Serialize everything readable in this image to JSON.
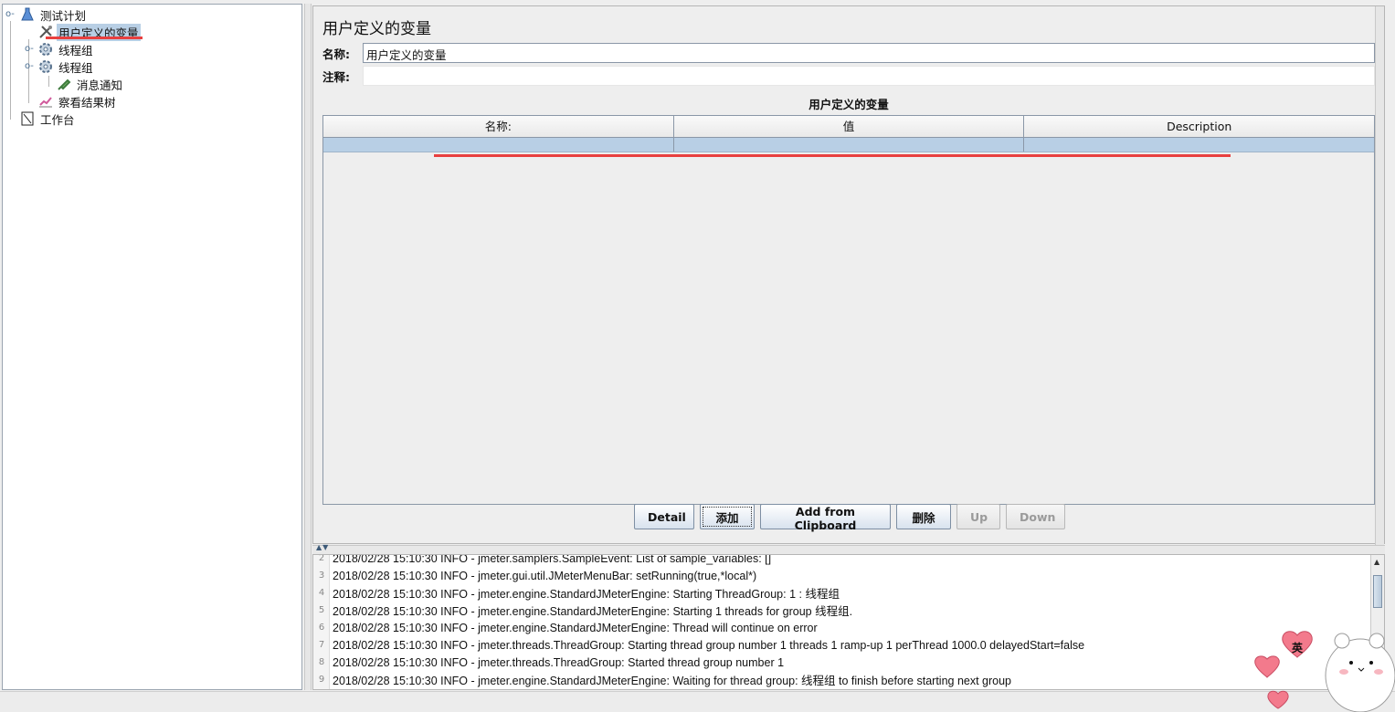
{
  "tree": {
    "items": [
      {
        "label": "测试计划",
        "icon": "flask-icon"
      },
      {
        "label": "用户定义的变量",
        "icon": "wrench-icon"
      },
      {
        "label": "线程组",
        "icon": "gear-icon"
      },
      {
        "label": "线程组",
        "icon": "gear-icon"
      },
      {
        "label": "消息通知",
        "icon": "syringe-icon"
      },
      {
        "label": "察看结果树",
        "icon": "chart-icon"
      },
      {
        "label": "工作台",
        "icon": "workbench-icon"
      }
    ]
  },
  "editor": {
    "title": "用户定义的变量",
    "name_label": "名称:",
    "name_value": "用户定义的变量",
    "comment_label": "注释:",
    "comment_value": "",
    "table_caption": "用户定义的变量",
    "columns": [
      "名称:",
      "值",
      "Description"
    ]
  },
  "buttons": {
    "detail": "Detail",
    "add": "添加",
    "add_clipboard": "Add from Clipboard",
    "delete": "删除",
    "up": "Up",
    "down": "Down"
  },
  "log": {
    "lines": [
      {
        "n": "2",
        "text": "2018/02/28 15:10:30 INFO  - jmeter.samplers.SampleEvent: List of sample_variables: []"
      },
      {
        "n": "3",
        "text": "2018/02/28 15:10:30 INFO  - jmeter.gui.util.JMeterMenuBar: setRunning(true,*local*)"
      },
      {
        "n": "4",
        "text": "2018/02/28 15:10:30 INFO  - jmeter.engine.StandardJMeterEngine: Starting ThreadGroup: 1 : 线程组"
      },
      {
        "n": "5",
        "text": "2018/02/28 15:10:30 INFO  - jmeter.engine.StandardJMeterEngine: Starting 1 threads for group 线程组."
      },
      {
        "n": "6",
        "text": "2018/02/28 15:10:30 INFO  - jmeter.engine.StandardJMeterEngine: Thread will continue on error"
      },
      {
        "n": "7",
        "text": "2018/02/28 15:10:30 INFO  - jmeter.threads.ThreadGroup: Starting thread group number 1 threads 1 ramp-up 1 perThread 1000.0 delayedStart=false"
      },
      {
        "n": "8",
        "text": "2018/02/28 15:10:30 INFO  - jmeter.threads.ThreadGroup: Started thread group number 1"
      },
      {
        "n": "9",
        "text": "2018/02/28 15:10:30 INFO  - jmeter.engine.StandardJMeterEngine: Waiting for thread group: 线程组 to finish before starting next group"
      }
    ]
  },
  "sticker": {
    "badge": "英"
  },
  "colors": {
    "annotation": "#e8403f",
    "selection": "#b8cfe5"
  }
}
